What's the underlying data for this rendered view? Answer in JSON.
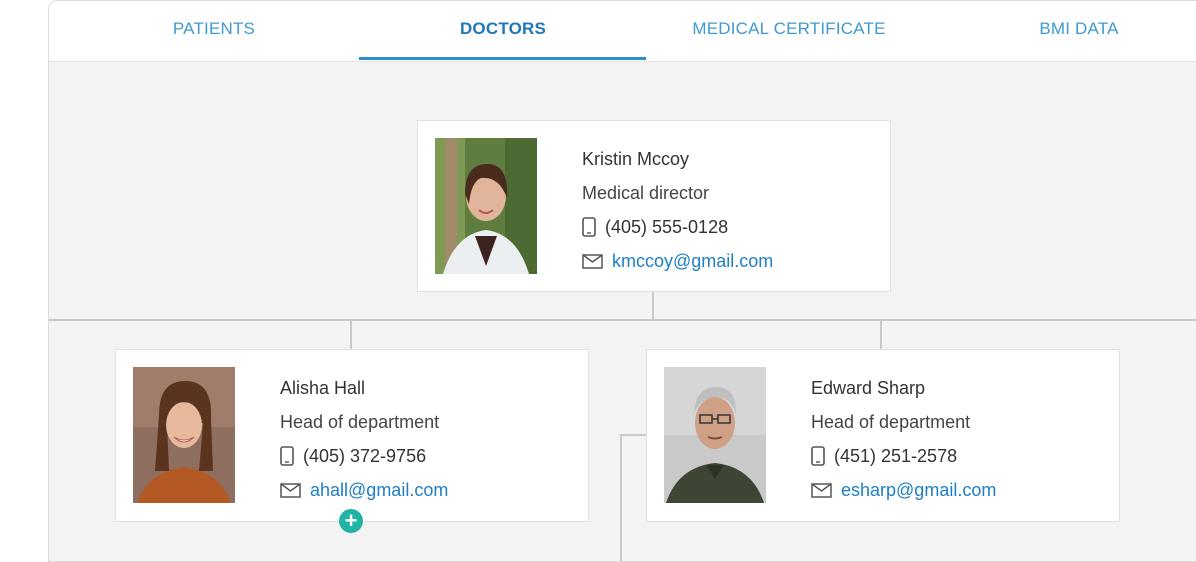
{
  "tabs": [
    {
      "label": "PATIENTS"
    },
    {
      "label": "DOCTORS"
    },
    {
      "label": "MEDICAL CERTIFICATE"
    },
    {
      "label": "BMI DATA"
    }
  ],
  "active_tab": "DOCTORS",
  "doctors": [
    {
      "name": "Kristin Mccoy",
      "role": "Medical director",
      "phone": "(405) 555-0128",
      "email": "kmccoy@gmail.com"
    },
    {
      "name": "Alisha Hall",
      "role": "Head of department",
      "phone": "(405) 372-9756",
      "email": "ahall@gmail.com"
    },
    {
      "name": "Edward Sharp",
      "role": "Head of department",
      "phone": "(451) 251-2578",
      "email": "esharp@gmail.com"
    }
  ],
  "icons": {
    "phone": "phone-icon",
    "email": "mail-icon",
    "add": "plus-circle-icon"
  },
  "colors": {
    "accent": "#1d7fc4",
    "add_button": "#21b3a3",
    "background": "#f3f3f3"
  }
}
